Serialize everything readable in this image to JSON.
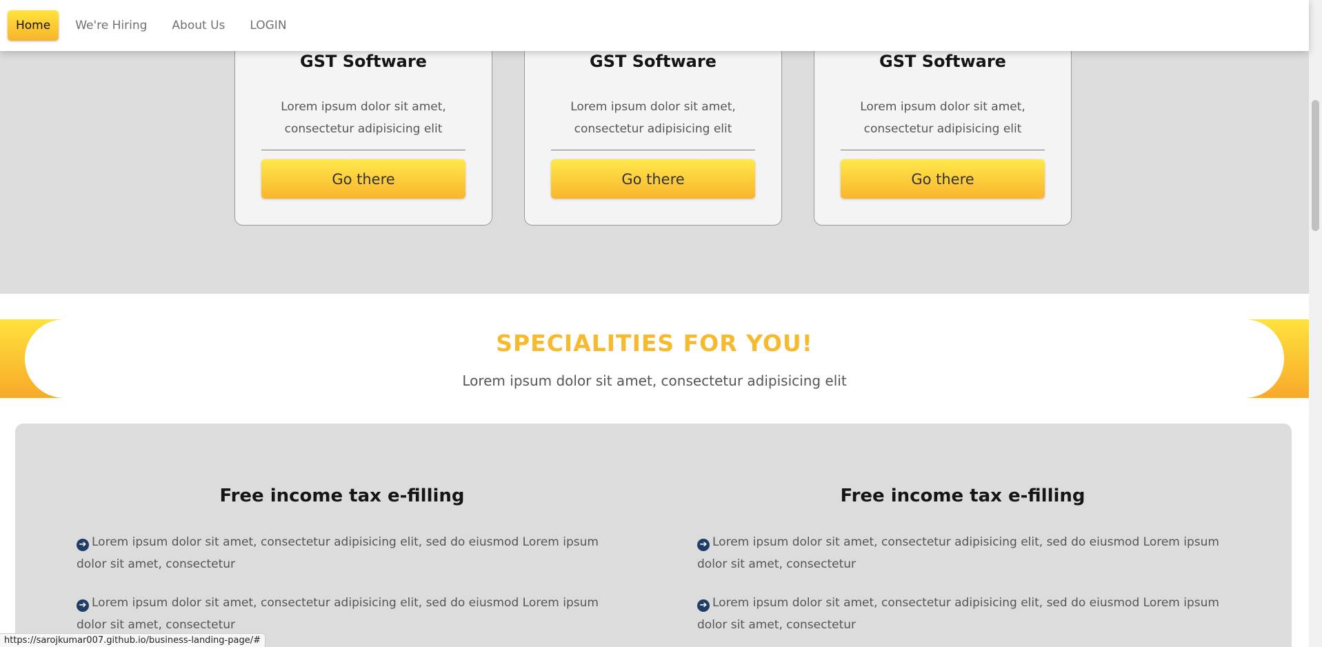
{
  "nav": {
    "items": [
      {
        "label": "Home",
        "active": true
      },
      {
        "label": "We're Hiring",
        "active": false
      },
      {
        "label": "About Us",
        "active": false
      },
      {
        "label": "LOGIN",
        "active": false
      }
    ]
  },
  "cards": [
    {
      "title": "GST Software",
      "text": "Lorem ipsum dolor sit amet, consectetur adipisicing elit",
      "button": "Go there"
    },
    {
      "title": "GST Software",
      "text": "Lorem ipsum dolor sit amet, consectetur adipisicing elit",
      "button": "Go there"
    },
    {
      "title": "GST Software",
      "text": "Lorem ipsum dolor sit amet, consectetur adipisicing elit",
      "button": "Go there"
    }
  ],
  "specialities": {
    "title": "SPECIALITIES FOR YOU!",
    "subtitle": "Lorem ipsum dolor sit amet, consectetur adipisicing elit"
  },
  "features": [
    {
      "heading": "Free income tax e-filling",
      "items": [
        "Lorem ipsum dolor sit amet, consectetur adipisicing elit, sed do eiusmod Lorem ipsum dolor sit amet, consectetur",
        "Lorem ipsum dolor sit amet, consectetur adipisicing elit, sed do eiusmod Lorem ipsum dolor sit amet, consectetur"
      ]
    },
    {
      "heading": "Free income tax e-filling",
      "items": [
        "Lorem ipsum dolor sit amet, consectetur adipisicing elit, sed do eiusmod Lorem ipsum dolor sit amet, consectetur",
        "Lorem ipsum dolor sit amet, consectetur adipisicing elit, sed do eiusmod Lorem ipsum dolor sit amet, consectetur"
      ]
    }
  ],
  "status_url": "https://sarojkumar007.github.io/business-landing-page/#",
  "colors": {
    "accent_yellow": "#ffe33b",
    "accent_orange": "#f8b42c",
    "title_gold": "#f7b92e",
    "section_grey": "#dcdcdc",
    "icon_navy": "#1f3d66"
  },
  "icons": {
    "bullet": "arrow-circle-right-icon"
  }
}
